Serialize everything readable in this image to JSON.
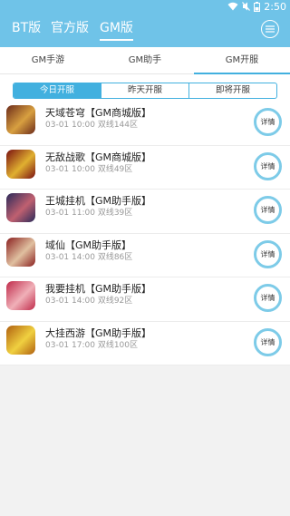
{
  "status_bar": {
    "time": "2:50"
  },
  "header": {
    "tabs": [
      {
        "label": "BT版"
      },
      {
        "label": "官方版"
      },
      {
        "label": "GM版"
      }
    ]
  },
  "subtabs": [
    {
      "label": "GM手游"
    },
    {
      "label": "GM助手"
    },
    {
      "label": "GM开服"
    }
  ],
  "segment": [
    {
      "label": "今日开服"
    },
    {
      "label": "昨天开服"
    },
    {
      "label": "即将开服"
    }
  ],
  "games": [
    {
      "name": "天域苍穹【GM商城版】",
      "date": "03-01 10:00",
      "server": "双线144区",
      "detail": "详情",
      "icon_colors": [
        "#6b2a1a",
        "#d8a040"
      ]
    },
    {
      "name": "无敌战歌【GM商城版】",
      "date": "03-01 10:00",
      "server": "双线49区",
      "detail": "详情",
      "icon_colors": [
        "#7a1010",
        "#e0b030"
      ]
    },
    {
      "name": "王城挂机【GM助手版】",
      "date": "03-01 11:00",
      "server": "双线39区",
      "detail": "详情",
      "icon_colors": [
        "#2a2a5a",
        "#c06070"
      ]
    },
    {
      "name": "域仙【GM助手版】",
      "date": "03-01 14:00",
      "server": "双线86区",
      "detail": "详情",
      "icon_colors": [
        "#8a2020",
        "#e0c0a0"
      ]
    },
    {
      "name": "我要挂机【GM助手版】",
      "date": "03-01 14:00",
      "server": "双线92区",
      "detail": "详情",
      "icon_colors": [
        "#c02a4a",
        "#f0b0b8"
      ]
    },
    {
      "name": "大挂西游【GM助手版】",
      "date": "03-01 17:00",
      "server": "双线100区",
      "detail": "详情",
      "icon_colors": [
        "#b06010",
        "#f0d040"
      ]
    }
  ]
}
